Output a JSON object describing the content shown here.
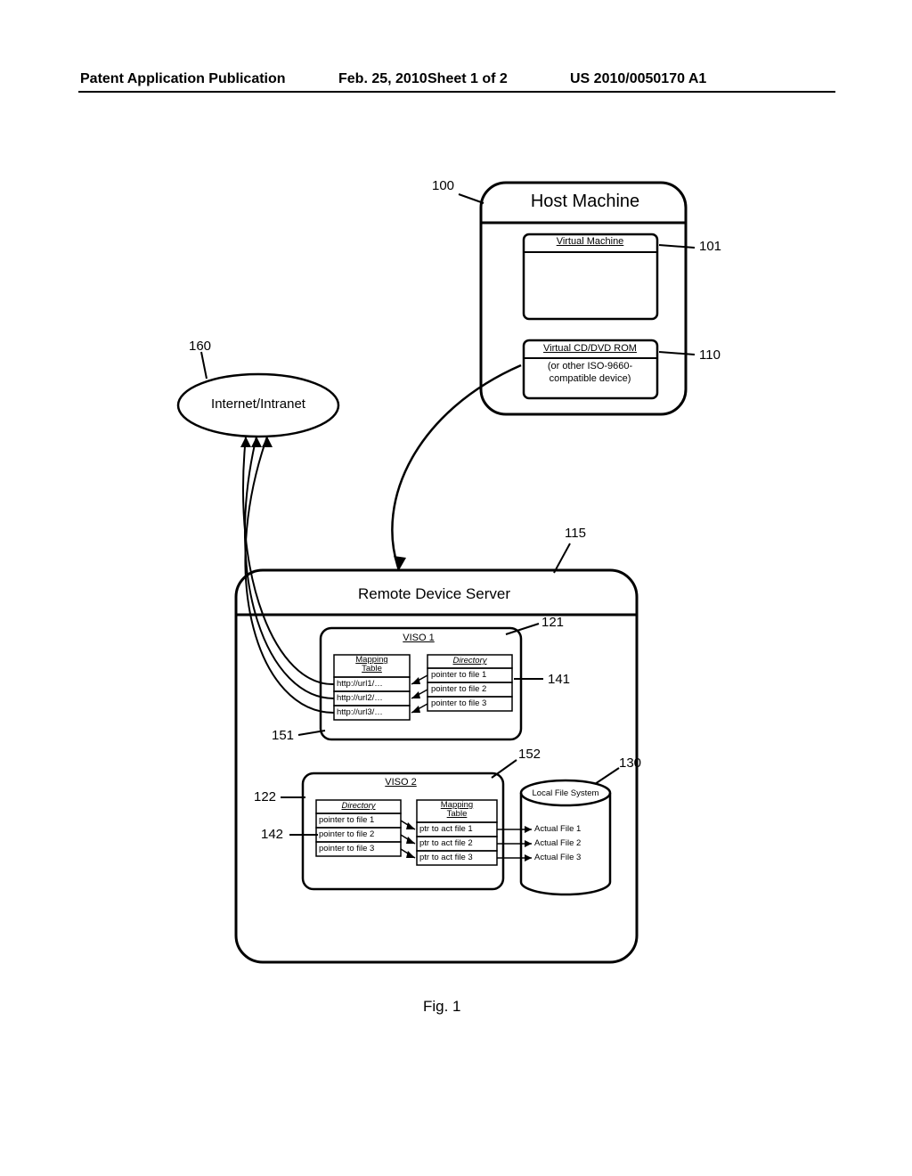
{
  "header": {
    "pub_type": "Patent Application Publication",
    "date": "Feb. 25, 2010",
    "sheet": "Sheet 1 of 2",
    "pub_number": "US 2010/0050170 A1"
  },
  "refs": {
    "host": "100",
    "vm": "101",
    "vcd": "110",
    "rds": "115",
    "viso1": "121",
    "viso2": "122",
    "lfs": "130",
    "dir1": "141",
    "dir2": "142",
    "map1": "151",
    "map2": "152",
    "net": "160"
  },
  "labels": {
    "host": "Host Machine",
    "vm": "Virtual Machine",
    "vcd1": "Virtual CD/DVD ROM",
    "vcd2": "(or other ISO-9660-",
    "vcd3": "compatible device)",
    "net": "Internet/Intranet",
    "rds": "Remote Device Server",
    "viso1": "VISO 1",
    "viso2": "VISO 2",
    "map_table": "Mapping",
    "map_table2": "Table",
    "directory": "Directory",
    "url1": "http://url1/…",
    "url2": "http://url2/…",
    "url3": "http://url3/…",
    "ptr1": "pointer to file 1",
    "ptr2": "pointer to file 2",
    "ptr3": "pointer to file 3",
    "ptract1": "ptr to act file 1",
    "ptract2": "ptr to act file 2",
    "ptract3": "ptr to act file 3",
    "lfs": "Local File System",
    "af1": "Actual File 1",
    "af2": "Actual File 2",
    "af3": "Actual File 3",
    "fig": "Fig. 1"
  }
}
